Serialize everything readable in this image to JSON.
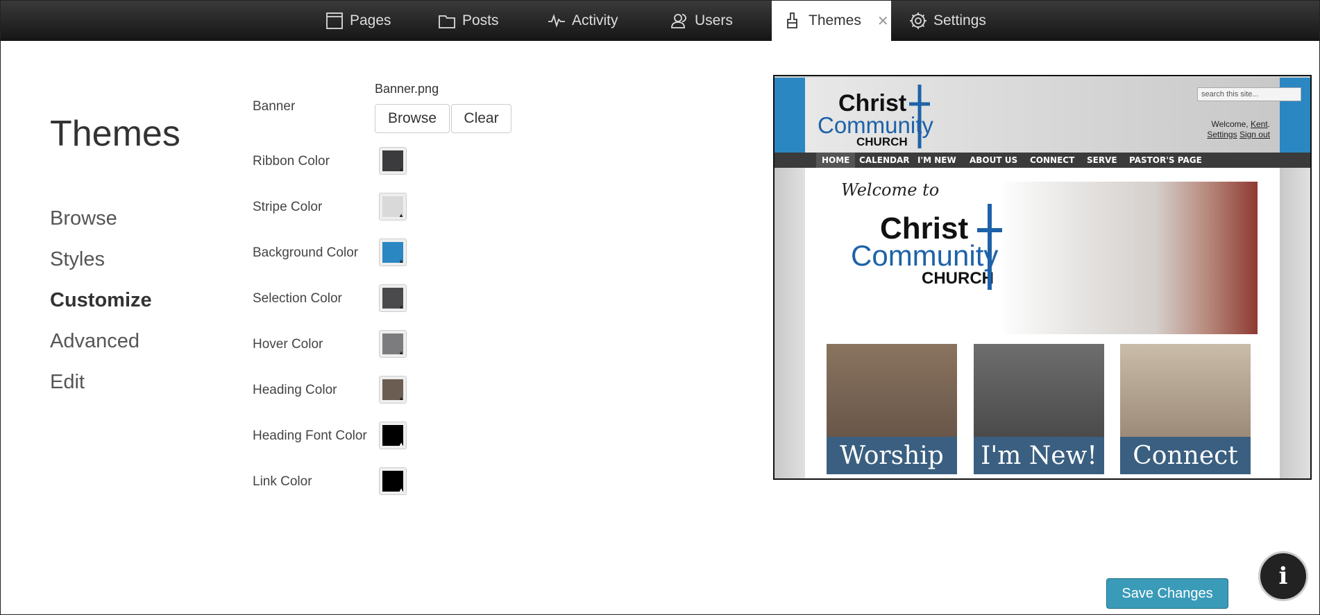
{
  "nav": {
    "tabs": [
      {
        "label": "Pages",
        "icon": "page-icon"
      },
      {
        "label": "Posts",
        "icon": "folder-icon"
      },
      {
        "label": "Activity",
        "icon": "activity-icon"
      },
      {
        "label": "Users",
        "icon": "users-icon"
      },
      {
        "label": "Themes",
        "icon": "brush-icon",
        "active": true
      },
      {
        "label": "Settings",
        "icon": "gear-icon"
      }
    ],
    "close_glyph": "✕"
  },
  "page_title": "Themes",
  "sidebar": {
    "items": [
      {
        "label": "Browse"
      },
      {
        "label": "Styles"
      },
      {
        "label": "Customize",
        "active": true
      },
      {
        "label": "Advanced"
      },
      {
        "label": "Edit"
      }
    ]
  },
  "form": {
    "banner_label": "Banner",
    "banner_file": "Banner.png",
    "browse_label": "Browse",
    "clear_label": "Clear",
    "colors": [
      {
        "label": "Ribbon Color",
        "value": "#3b3b3d"
      },
      {
        "label": "Stripe Color",
        "value": "#d9d9d9"
      },
      {
        "label": "Background Color",
        "value": "#2a87c2"
      },
      {
        "label": "Selection Color",
        "value": "#4a4a4c"
      },
      {
        "label": "Hover Color",
        "value": "#7c7c7e"
      },
      {
        "label": "Heading Color",
        "value": "#6b5d52"
      },
      {
        "label": "Heading Font Color",
        "value": "#000000"
      },
      {
        "label": "Link Color",
        "value": "#000000"
      }
    ]
  },
  "preview": {
    "logo": {
      "line1": "Christ",
      "line2": "Community",
      "line3": "CHURCH"
    },
    "search_placeholder": "search this site...",
    "welcome_prefix": "Welcome, ",
    "welcome_user": "Kent",
    "welcome_suffix": ".",
    "settings_link": "Settings",
    "signout_link": "Sign out",
    "nav": [
      "HOME",
      "CALENDAR",
      "I'M NEW",
      "ABOUT US",
      "CONNECT",
      "SERVE",
      "PASTOR'S PAGE"
    ],
    "hero_welcome": "Welcome to",
    "cards": [
      "Worship",
      "I'm New!",
      "Connect"
    ]
  },
  "footer": {
    "save_label": "Save Changes",
    "info_glyph": "i"
  }
}
